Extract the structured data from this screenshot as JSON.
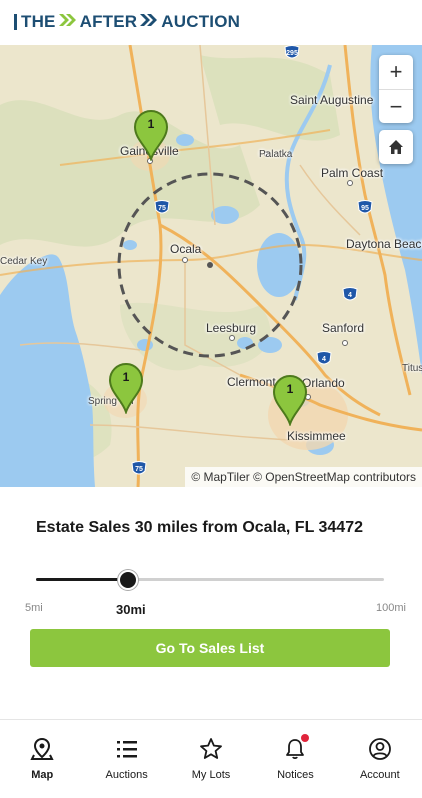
{
  "brand": {
    "logo_text_1": "THE",
    "logo_text_2": "AFTER",
    "logo_text_3": "AUCTION",
    "navy": "#1d4e73",
    "green": "#8cc63e"
  },
  "map": {
    "cities": [
      "Gainesville",
      "Palatka",
      "Saint Augustine",
      "Palm Coast",
      "Ocala",
      "Daytona Beach",
      "Cedar Key",
      "Leesburg",
      "Sanford",
      "Clermont",
      "Orlando",
      "Kissimmee",
      "Spring Hill",
      "Titusville"
    ],
    "highways": [
      "295",
      "75",
      "95",
      "4",
      "4",
      "75"
    ],
    "markers": [
      {
        "count": "1",
        "place": "Gainesville"
      },
      {
        "count": "1",
        "place": "Spring Hill"
      },
      {
        "count": "1",
        "place": "Orlando"
      }
    ],
    "zoom_in_label": "+",
    "zoom_out_label": "−",
    "attribution": "© MapTiler © OpenStreetMap contributors",
    "home_icon": "home-icon"
  },
  "panel": {
    "headline": "Estate Sales 30 miles from Ocala, FL 34472",
    "slider": {
      "min_label": "5mi",
      "current_label": "30mi",
      "max_label": "100mi",
      "min": 5,
      "value": 30,
      "max": 100
    },
    "cta_label": "Go To Sales List"
  },
  "nav": {
    "items": [
      {
        "label": "Map",
        "icon": "map-pin-icon",
        "active": true
      },
      {
        "label": "Auctions",
        "icon": "list-icon",
        "active": false
      },
      {
        "label": "My Lots",
        "icon": "star-icon",
        "active": false
      },
      {
        "label": "Notices",
        "icon": "bell-icon",
        "active": false,
        "badge": true
      },
      {
        "label": "Account",
        "icon": "account-icon",
        "active": false
      }
    ],
    "badge_color": "#e0243b"
  }
}
